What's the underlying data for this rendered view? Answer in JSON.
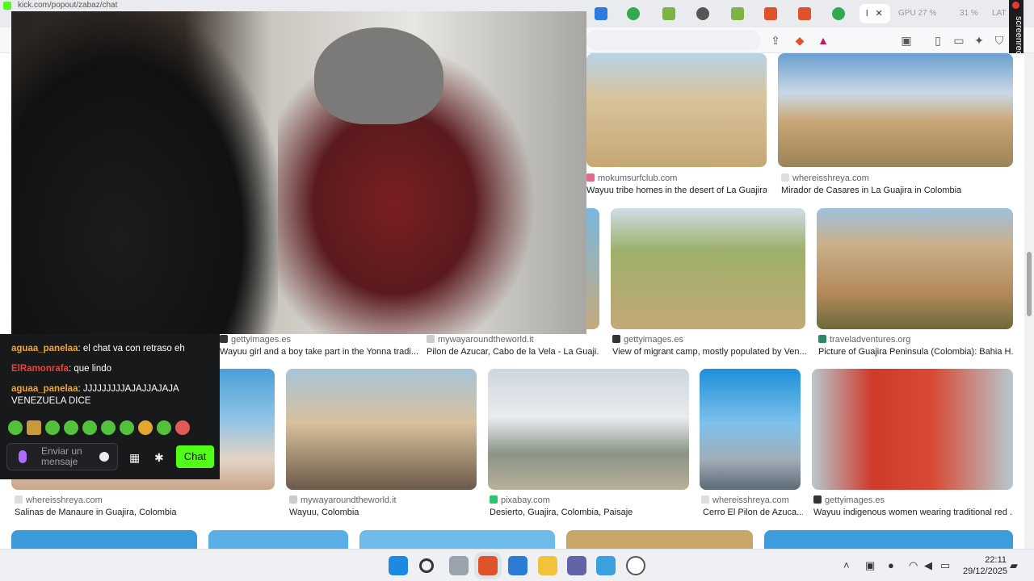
{
  "browser": {
    "url_fragment": "kick.com/popout/zabaz/chat",
    "active_tab_label": "l",
    "tab_stats": [
      "GPU 27 %",
      "31 %",
      "LAT"
    ],
    "recorder_label": "screenrec"
  },
  "results": [
    {
      "source": "mokumsurfclub.com",
      "title": "Wayuu tribe homes in the desert of La Guajira...",
      "colors": [
        "#d8c39a",
        "#c6a775"
      ]
    },
    {
      "source": "whereisshreya.com",
      "title": "Mirador de Casares in La Guajira in Colombia",
      "colors": [
        "#8ab3d6",
        "#c9a676"
      ]
    },
    {
      "source": "gettyimages.es",
      "title": "Wayuu girl and a boy take part in the Yonna tradi...",
      "colors": [
        "#b28f5c",
        "#e0c79d"
      ]
    },
    {
      "source": "mywayaroundtheworld.it",
      "title": "Pilon de Azucar, Cabo de la Vela - La Guaji...",
      "colors": [
        "#7ab8e0",
        "#c7a87c"
      ]
    },
    {
      "source": "gettyimages.es",
      "title": "View of migrant camp, mostly populated by Ven...",
      "colors": [
        "#9db06a",
        "#c4a879"
      ]
    },
    {
      "source": "traveladventures.org",
      "title": "Picture of Guajira Peninsula (Colombia): Bahia H...",
      "colors": [
        "#9fc1dd",
        "#b4895a"
      ]
    },
    {
      "source": "whereisshreya.com",
      "title": "Salinas de Manaure in Guajira, Colombia",
      "colors": [
        "#4b9fd8",
        "#e4d4c6"
      ]
    },
    {
      "source": "mywayaroundtheworld.it",
      "title": "Wayuu, Colombia",
      "colors": [
        "#a8c4d8",
        "#d8c09c"
      ]
    },
    {
      "source": "pixabay.com",
      "title": "Desierto, Guajira, Colombia, Paisaje",
      "colors": [
        "#cfd6dc",
        "#8b9487"
      ]
    },
    {
      "source": "whereisshreya.com",
      "title": "Cerro El Pilon de Azuca...",
      "colors": [
        "#1d8fd8",
        "#a1adb7"
      ]
    },
    {
      "source": "gettyimages.es",
      "title": "Wayuu indigenous women wearing traditional red ...",
      "colors": [
        "#b7c8cf",
        "#cf3a2a"
      ]
    }
  ],
  "chat": {
    "messages": [
      {
        "user": "aguaa_panelaa",
        "text": ": el chat va con retraso eh",
        "color": "#f5a623"
      },
      {
        "user": "ElRamonrafa",
        "text": ": que lindo",
        "color": "#e8443a"
      },
      {
        "user": "aguaa_panelaa",
        "text": ": JJJJJJJJJAJAJJAJAJA VENEZUELA DICE",
        "color": "#f5a623"
      }
    ],
    "input_placeholder": "Enviar un mensaje",
    "send_label": "Chat"
  },
  "taskbar": {
    "time": "22:11",
    "date": "29/12/2025"
  }
}
